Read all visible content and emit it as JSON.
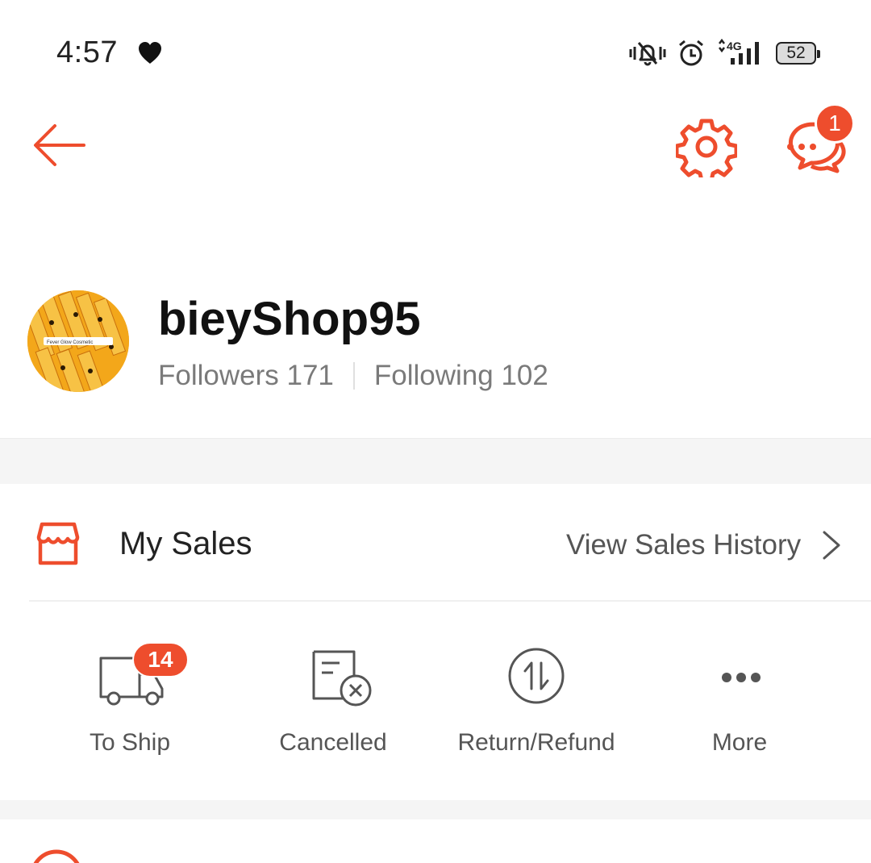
{
  "status_bar": {
    "time": "4:57",
    "battery": "52",
    "network": "4G"
  },
  "header": {
    "chat_badge": "1",
    "icons": [
      "arrow-left-icon",
      "gear-icon",
      "chat-icon"
    ]
  },
  "profile": {
    "shop_name": "bieyShop95",
    "followers_label": "Followers",
    "followers_count": "171",
    "following_label": "Following",
    "following_count": "102",
    "avatar_caption": "Fever Glow Cosmetic"
  },
  "my_sales": {
    "title": "My Sales",
    "view_history": "View Sales History",
    "items": [
      {
        "label": "To Ship",
        "badge": "14",
        "icon": "truck-icon"
      },
      {
        "label": "Cancelled",
        "icon": "cancelled-doc-icon"
      },
      {
        "label": "Return/Refund",
        "icon": "return-refund-icon"
      },
      {
        "label": "More",
        "icon": "more-dots-icon"
      }
    ]
  },
  "colors": {
    "accent": "#ee4d2d",
    "text_primary": "#222222",
    "text_secondary": "#7a7a7a",
    "band": "#f5f5f5"
  }
}
